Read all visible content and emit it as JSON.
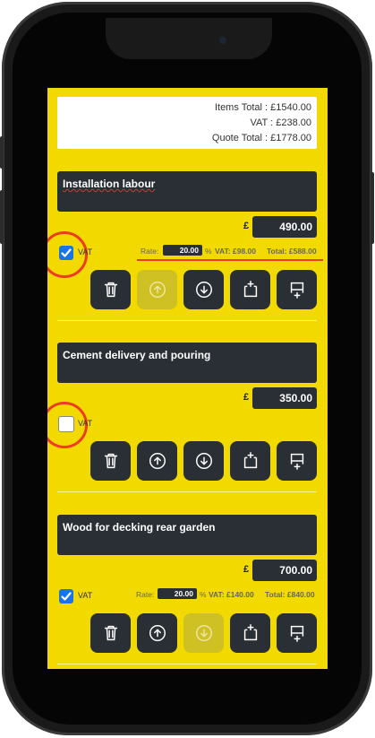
{
  "totals": {
    "items_total": "Items Total : £1540.00",
    "vat": "VAT : £238.00",
    "quote_total": "Quote Total : £1778.00"
  },
  "currency_symbol": "£",
  "vat_label": "VAT",
  "rate_label": "Rate:",
  "percent_sign": "%",
  "items": [
    {
      "description": "Installation labour",
      "price": "490.00",
      "vat_checked": true,
      "rate": "20.00",
      "vat_amount": "VAT: £98.00",
      "total": "Total: £588.00",
      "move_up_enabled": false,
      "move_down_enabled": true
    },
    {
      "description": "Cement delivery and pouring",
      "price": "350.00",
      "vat_checked": false,
      "move_up_enabled": true,
      "move_down_enabled": true
    },
    {
      "description": "Wood for decking rear garden",
      "price": "700.00",
      "vat_checked": true,
      "rate": "20.00",
      "vat_amount": "VAT: £140.00",
      "total": "Total: £840.00",
      "move_up_enabled": true,
      "move_down_enabled": false
    }
  ],
  "icons": [
    "trash-icon",
    "arrow-up-circle-icon",
    "arrow-down-circle-icon",
    "insert-above-icon",
    "insert-below-icon"
  ],
  "colors": {
    "background": "#f2d900",
    "field": "#2a2f35",
    "highlight": "#ee3b24",
    "checkbox": "#1a73e8"
  }
}
